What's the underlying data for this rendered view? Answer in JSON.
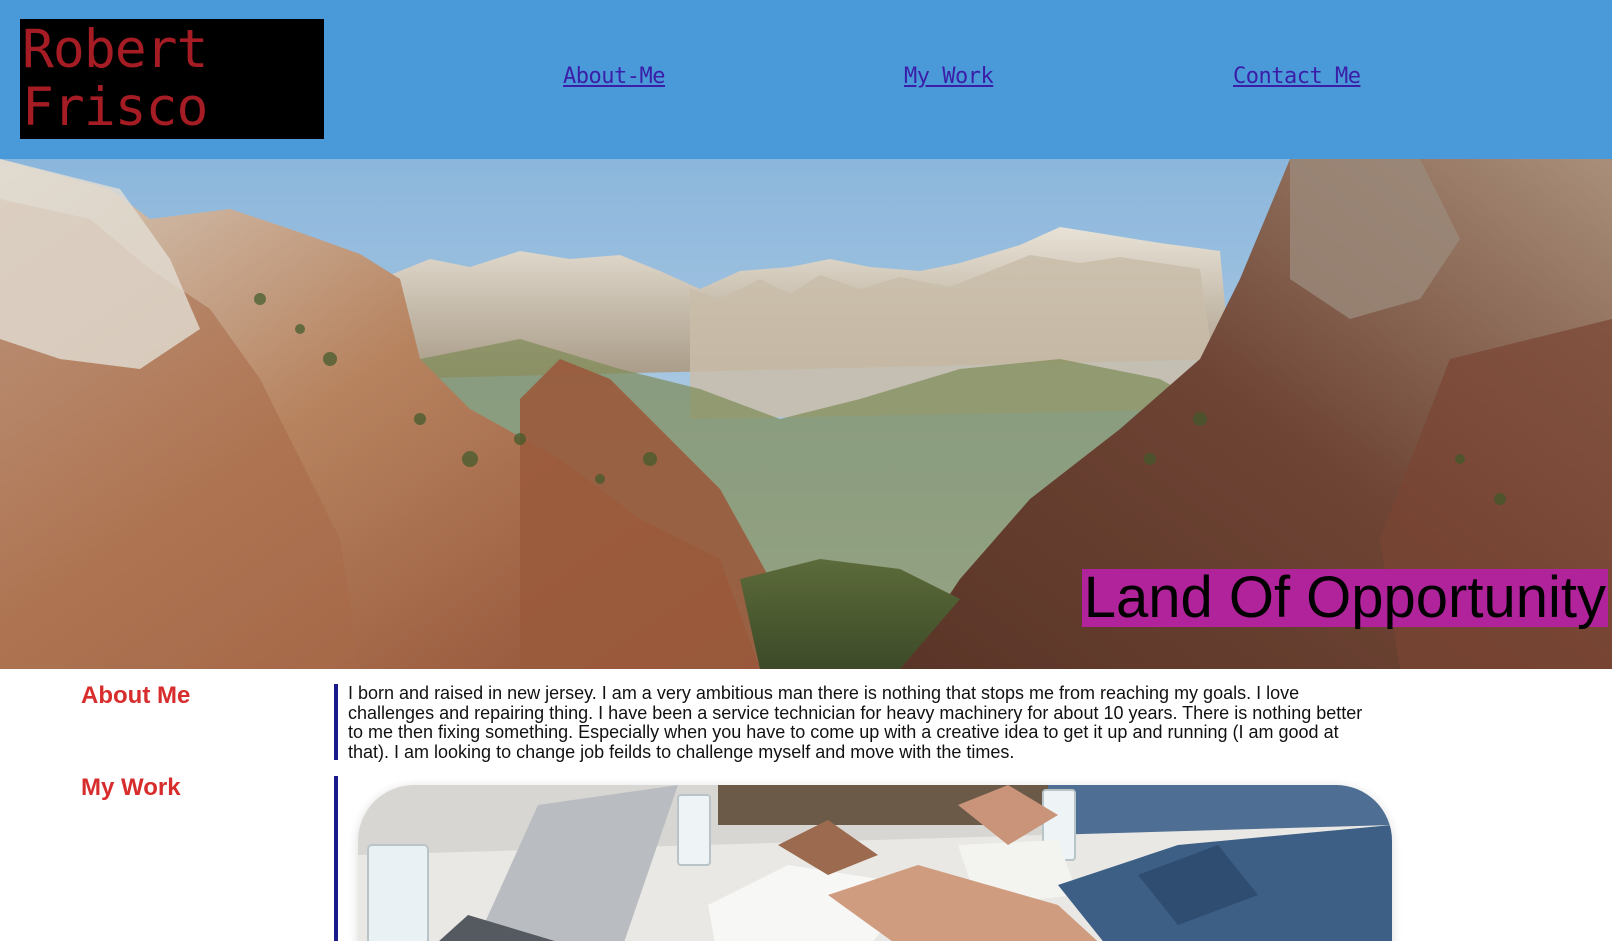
{
  "header": {
    "logo_line1": "Robert",
    "logo_line2": "Frisco",
    "nav": [
      {
        "label": "About-Me"
      },
      {
        "label": "My Work"
      },
      {
        "label": "Contact Me"
      }
    ],
    "background": "#4a9ada",
    "link_color": "#3b1ea8",
    "logo_color": "#a51c24"
  },
  "hero": {
    "tagline": "Land Of Opportunity",
    "tagline_bg": "#b0239a"
  },
  "about": {
    "heading": "About Me",
    "text": "I born and raised in new jersey. I am a very ambitious man there is nothing that stops me from reaching my goals. I love challenges and repairing thing. I have been a service technician for heavy machinery for about 10 years. There is nothing better to me then fixing something. Especially when you have to come up with a creative idea to get it up and running (I am good at that). I am looking to change job feilds to challenge myself and move with the times."
  },
  "work": {
    "heading": "My Work"
  },
  "colors": {
    "heading_red": "#d72d2d",
    "divider_navy": "#1a1a8c"
  }
}
